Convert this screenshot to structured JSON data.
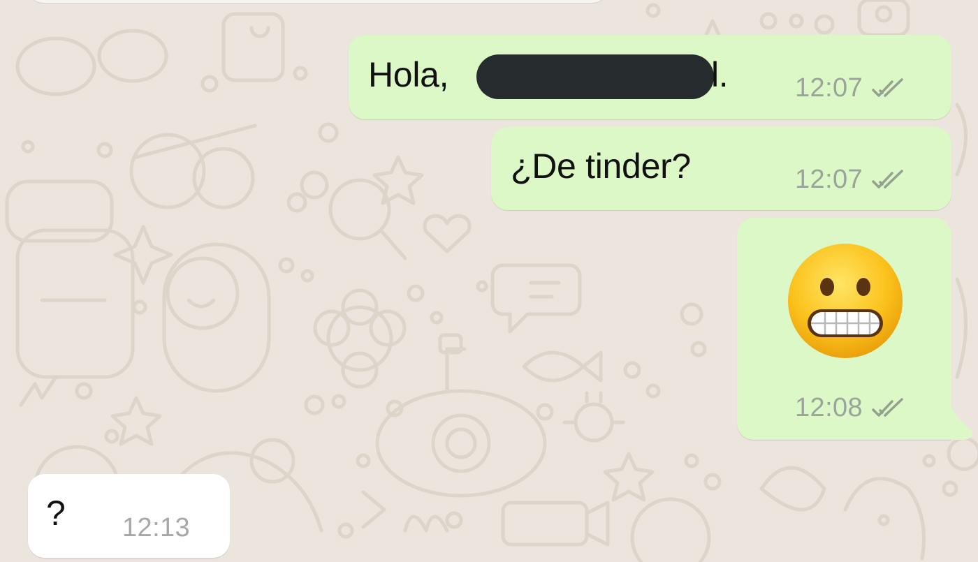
{
  "chat": {
    "messages": [
      {
        "id": "msg-1",
        "direction": "outgoing",
        "text_visible_start": "Hola,",
        "text_visible_end": "l.",
        "time": "12:07",
        "status_icon": "double-check-icon"
      },
      {
        "id": "msg-2",
        "direction": "outgoing",
        "text": "¿De tinder?",
        "time": "12:07",
        "status_icon": "double-check-icon"
      },
      {
        "id": "msg-3",
        "direction": "outgoing",
        "emoji": "grimacing-face-emoji",
        "time": "12:08",
        "status_icon": "double-check-icon"
      },
      {
        "id": "msg-4",
        "direction": "incoming",
        "text": "?",
        "time": "12:13"
      }
    ]
  },
  "theme": {
    "background": "#ece5dd",
    "outgoing_bubble": "#dcf8c6",
    "incoming_bubble": "#ffffff",
    "time_color": "#9aa49a",
    "redaction_color": "#262b2e"
  }
}
